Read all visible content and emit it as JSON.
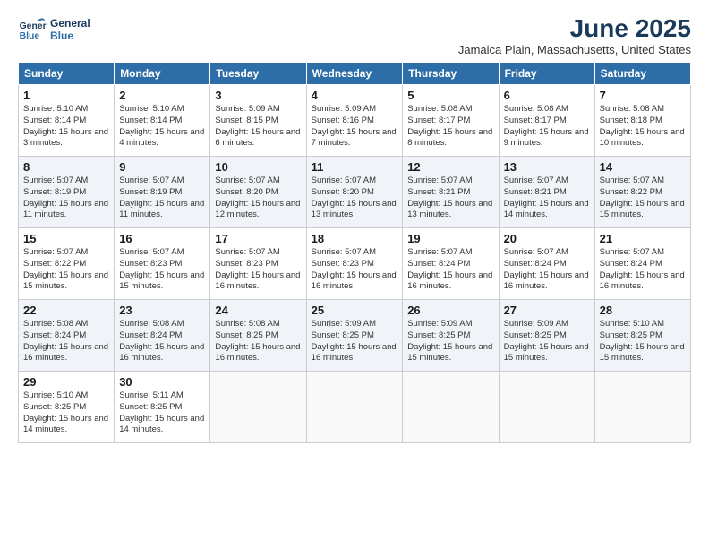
{
  "header": {
    "logo_line1": "General",
    "logo_line2": "Blue",
    "month_year": "June 2025",
    "location": "Jamaica Plain, Massachusetts, United States"
  },
  "weekdays": [
    "Sunday",
    "Monday",
    "Tuesday",
    "Wednesday",
    "Thursday",
    "Friday",
    "Saturday"
  ],
  "weeks": [
    [
      {
        "day": "1",
        "sunrise": "Sunrise: 5:10 AM",
        "sunset": "Sunset: 8:14 PM",
        "daylight": "Daylight: 15 hours and 3 minutes."
      },
      {
        "day": "2",
        "sunrise": "Sunrise: 5:10 AM",
        "sunset": "Sunset: 8:14 PM",
        "daylight": "Daylight: 15 hours and 4 minutes."
      },
      {
        "day": "3",
        "sunrise": "Sunrise: 5:09 AM",
        "sunset": "Sunset: 8:15 PM",
        "daylight": "Daylight: 15 hours and 6 minutes."
      },
      {
        "day": "4",
        "sunrise": "Sunrise: 5:09 AM",
        "sunset": "Sunset: 8:16 PM",
        "daylight": "Daylight: 15 hours and 7 minutes."
      },
      {
        "day": "5",
        "sunrise": "Sunrise: 5:08 AM",
        "sunset": "Sunset: 8:17 PM",
        "daylight": "Daylight: 15 hours and 8 minutes."
      },
      {
        "day": "6",
        "sunrise": "Sunrise: 5:08 AM",
        "sunset": "Sunset: 8:17 PM",
        "daylight": "Daylight: 15 hours and 9 minutes."
      },
      {
        "day": "7",
        "sunrise": "Sunrise: 5:08 AM",
        "sunset": "Sunset: 8:18 PM",
        "daylight": "Daylight: 15 hours and 10 minutes."
      }
    ],
    [
      {
        "day": "8",
        "sunrise": "Sunrise: 5:07 AM",
        "sunset": "Sunset: 8:19 PM",
        "daylight": "Daylight: 15 hours and 11 minutes."
      },
      {
        "day": "9",
        "sunrise": "Sunrise: 5:07 AM",
        "sunset": "Sunset: 8:19 PM",
        "daylight": "Daylight: 15 hours and 11 minutes."
      },
      {
        "day": "10",
        "sunrise": "Sunrise: 5:07 AM",
        "sunset": "Sunset: 8:20 PM",
        "daylight": "Daylight: 15 hours and 12 minutes."
      },
      {
        "day": "11",
        "sunrise": "Sunrise: 5:07 AM",
        "sunset": "Sunset: 8:20 PM",
        "daylight": "Daylight: 15 hours and 13 minutes."
      },
      {
        "day": "12",
        "sunrise": "Sunrise: 5:07 AM",
        "sunset": "Sunset: 8:21 PM",
        "daylight": "Daylight: 15 hours and 13 minutes."
      },
      {
        "day": "13",
        "sunrise": "Sunrise: 5:07 AM",
        "sunset": "Sunset: 8:21 PM",
        "daylight": "Daylight: 15 hours and 14 minutes."
      },
      {
        "day": "14",
        "sunrise": "Sunrise: 5:07 AM",
        "sunset": "Sunset: 8:22 PM",
        "daylight": "Daylight: 15 hours and 15 minutes."
      }
    ],
    [
      {
        "day": "15",
        "sunrise": "Sunrise: 5:07 AM",
        "sunset": "Sunset: 8:22 PM",
        "daylight": "Daylight: 15 hours and 15 minutes."
      },
      {
        "day": "16",
        "sunrise": "Sunrise: 5:07 AM",
        "sunset": "Sunset: 8:23 PM",
        "daylight": "Daylight: 15 hours and 15 minutes."
      },
      {
        "day": "17",
        "sunrise": "Sunrise: 5:07 AM",
        "sunset": "Sunset: 8:23 PM",
        "daylight": "Daylight: 15 hours and 16 minutes."
      },
      {
        "day": "18",
        "sunrise": "Sunrise: 5:07 AM",
        "sunset": "Sunset: 8:23 PM",
        "daylight": "Daylight: 15 hours and 16 minutes."
      },
      {
        "day": "19",
        "sunrise": "Sunrise: 5:07 AM",
        "sunset": "Sunset: 8:24 PM",
        "daylight": "Daylight: 15 hours and 16 minutes."
      },
      {
        "day": "20",
        "sunrise": "Sunrise: 5:07 AM",
        "sunset": "Sunset: 8:24 PM",
        "daylight": "Daylight: 15 hours and 16 minutes."
      },
      {
        "day": "21",
        "sunrise": "Sunrise: 5:07 AM",
        "sunset": "Sunset: 8:24 PM",
        "daylight": "Daylight: 15 hours and 16 minutes."
      }
    ],
    [
      {
        "day": "22",
        "sunrise": "Sunrise: 5:08 AM",
        "sunset": "Sunset: 8:24 PM",
        "daylight": "Daylight: 15 hours and 16 minutes."
      },
      {
        "day": "23",
        "sunrise": "Sunrise: 5:08 AM",
        "sunset": "Sunset: 8:24 PM",
        "daylight": "Daylight: 15 hours and 16 minutes."
      },
      {
        "day": "24",
        "sunrise": "Sunrise: 5:08 AM",
        "sunset": "Sunset: 8:25 PM",
        "daylight": "Daylight: 15 hours and 16 minutes."
      },
      {
        "day": "25",
        "sunrise": "Sunrise: 5:09 AM",
        "sunset": "Sunset: 8:25 PM",
        "daylight": "Daylight: 15 hours and 16 minutes."
      },
      {
        "day": "26",
        "sunrise": "Sunrise: 5:09 AM",
        "sunset": "Sunset: 8:25 PM",
        "daylight": "Daylight: 15 hours and 15 minutes."
      },
      {
        "day": "27",
        "sunrise": "Sunrise: 5:09 AM",
        "sunset": "Sunset: 8:25 PM",
        "daylight": "Daylight: 15 hours and 15 minutes."
      },
      {
        "day": "28",
        "sunrise": "Sunrise: 5:10 AM",
        "sunset": "Sunset: 8:25 PM",
        "daylight": "Daylight: 15 hours and 15 minutes."
      }
    ],
    [
      {
        "day": "29",
        "sunrise": "Sunrise: 5:10 AM",
        "sunset": "Sunset: 8:25 PM",
        "daylight": "Daylight: 15 hours and 14 minutes."
      },
      {
        "day": "30",
        "sunrise": "Sunrise: 5:11 AM",
        "sunset": "Sunset: 8:25 PM",
        "daylight": "Daylight: 15 hours and 14 minutes."
      },
      {
        "day": "",
        "sunrise": "",
        "sunset": "",
        "daylight": ""
      },
      {
        "day": "",
        "sunrise": "",
        "sunset": "",
        "daylight": ""
      },
      {
        "day": "",
        "sunrise": "",
        "sunset": "",
        "daylight": ""
      },
      {
        "day": "",
        "sunrise": "",
        "sunset": "",
        "daylight": ""
      },
      {
        "day": "",
        "sunrise": "",
        "sunset": "",
        "daylight": ""
      }
    ]
  ]
}
